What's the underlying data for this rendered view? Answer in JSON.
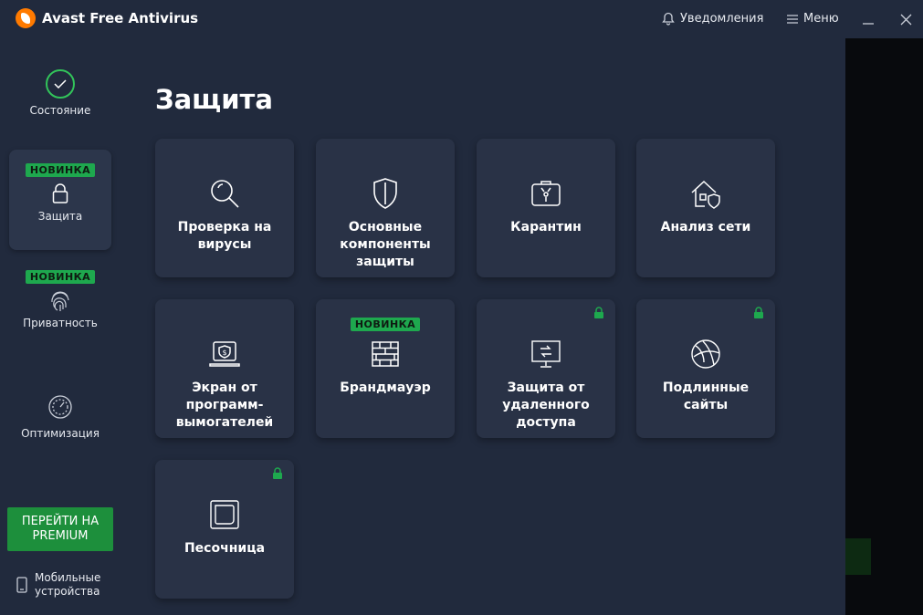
{
  "window": {
    "title": "Avast Free Antivirus",
    "notifications_label": "Уведомления",
    "menu_label": "Меню"
  },
  "sidebar": {
    "items": [
      {
        "label": "Состояние",
        "icon": "check-icon"
      },
      {
        "label": "Защита",
        "badge": "НОВИНКА",
        "icon": "lock-icon"
      },
      {
        "label": "Приватность",
        "badge": "НОВИНКА",
        "icon": "fingerprint-icon"
      },
      {
        "label": "Оптимизация",
        "icon": "gauge-icon"
      }
    ],
    "premium_label": "ПЕРЕЙТИ НА\nPREMIUM",
    "mobile_label": "Мобильные\nустройства"
  },
  "main": {
    "title": "Защита",
    "tiles": [
      {
        "label": "Проверка на\nвирусы",
        "icon": "magnifier-icon"
      },
      {
        "label": "Основные\nкомпоненты\nзащиты",
        "icon": "shield-icon"
      },
      {
        "label": "Карантин",
        "icon": "quarantine-box-icon"
      },
      {
        "label": "Анализ сети",
        "icon": "home-network-icon"
      },
      {
        "label": "Экран от\nпрограмм-\nвымогателей",
        "icon": "ransomware-laptop-icon"
      },
      {
        "label": "Брандмауэр",
        "badge": "НОВИНКА",
        "icon": "brick-wall-icon"
      },
      {
        "label": "Защита от\nудаленного\nдоступа",
        "icon": "remote-monitor-icon",
        "locked": true
      },
      {
        "label": "Подлинные\nсайты",
        "icon": "globe-icon",
        "locked": true
      },
      {
        "label": "Песочница",
        "icon": "sandbox-icon",
        "locked": true
      }
    ]
  },
  "colors": {
    "background": "#212a3d",
    "tile": "#293246",
    "accent_green": "#1ea84e",
    "logo_orange": "#ff7a00"
  }
}
